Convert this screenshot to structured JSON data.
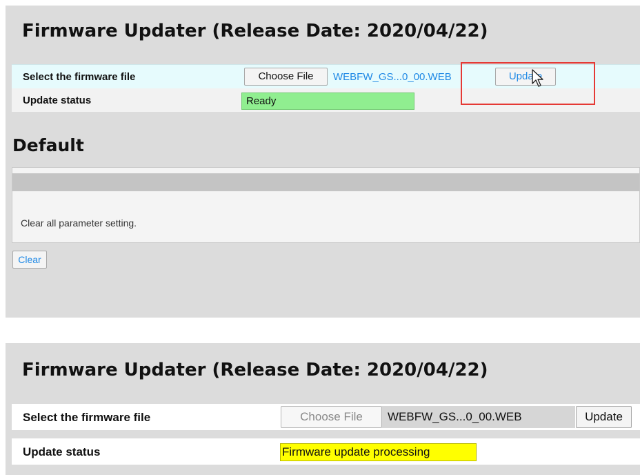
{
  "top_panel": {
    "title": "Firmware Updater (Release Date: 2020/04/22)",
    "select_label": "Select the firmware file",
    "choose_file_label": "Choose File",
    "file_name": "WEBFW_GS...0_00.WEB",
    "update_label": "Update",
    "status_label": "Update status",
    "status_value": "Ready",
    "status_color": "#90ee90"
  },
  "default_section": {
    "heading": "Default",
    "description": "Clear all parameter setting.",
    "clear_label": "Clear"
  },
  "bottom_panel": {
    "title": "Firmware Updater (Release Date: 2020/04/22)",
    "select_label": "Select the firmware file",
    "choose_file_label": "Choose File",
    "file_name": "WEBFW_GS...0_00.WEB",
    "update_label": "Update",
    "status_label": "Update status",
    "status_value": "Firmware update processing",
    "status_color": "#ffff00"
  },
  "colors": {
    "link_blue": "#1e88e5",
    "highlight_red": "#e53935",
    "panel_gray": "#dcdcdc"
  },
  "icons": {
    "cursor": "mouse-pointer-icon"
  }
}
